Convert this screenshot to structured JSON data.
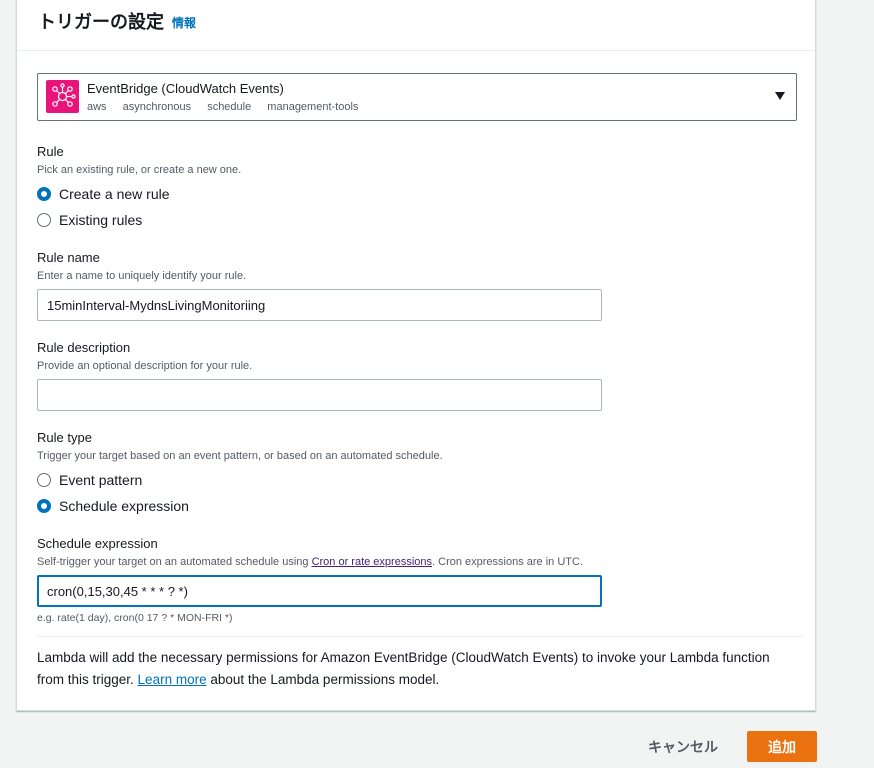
{
  "header": {
    "title": "トリガーの設定",
    "info": "情報"
  },
  "source": {
    "title": "EventBridge (CloudWatch Events)",
    "tags": [
      "aws",
      "asynchronous",
      "schedule",
      "management-tools"
    ],
    "icon": "eventbridge-icon"
  },
  "rule": {
    "label": "Rule",
    "description": "Pick an existing rule, or create a new one.",
    "options": [
      {
        "label": "Create a new rule",
        "checked": true
      },
      {
        "label": "Existing rules",
        "checked": false
      }
    ]
  },
  "rule_name": {
    "label": "Rule name",
    "description": "Enter a name to uniquely identify your rule.",
    "value": "15minInterval-MydnsLivingMonitoriing"
  },
  "rule_description": {
    "label": "Rule description",
    "description": "Provide an optional description for your rule.",
    "value": ""
  },
  "rule_type": {
    "label": "Rule type",
    "description": "Trigger your target based on an event pattern, or based on an automated schedule.",
    "options": [
      {
        "label": "Event pattern",
        "checked": false
      },
      {
        "label": "Schedule expression",
        "checked": true
      }
    ]
  },
  "schedule": {
    "label": "Schedule expression",
    "description_prefix": "Self-trigger your target on an automated schedule using ",
    "description_link": "Cron or rate expressions",
    "description_suffix": ". Cron expressions are in UTC.",
    "value": "cron(0,15,30,45 * * * ? *)",
    "constraint": "e.g. rate(1 day), cron(0 17 ? * MON-FRI *)"
  },
  "footer": {
    "note_prefix": "Lambda will add the necessary permissions for Amazon EventBridge (CloudWatch Events) to invoke your Lambda function from this trigger. ",
    "note_link": "Learn more",
    "note_suffix": " about the Lambda permissions model."
  },
  "actions": {
    "cancel": "キャンセル",
    "add": "追加"
  },
  "colors": {
    "accent": "#0073bb",
    "primary_button": "#ec7211",
    "eventbridge": "#e7157b"
  }
}
